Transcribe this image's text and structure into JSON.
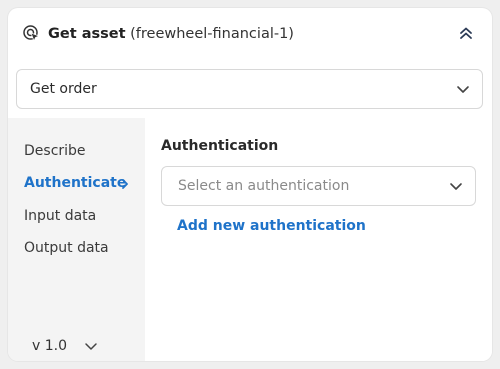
{
  "header": {
    "title": "Get asset",
    "subtitle": "(freewheel-financial-1)",
    "icons": {
      "title_icon": "cursor-click-icon",
      "collapse_icon": "double-chevron-up-icon"
    }
  },
  "operation_select": {
    "value": "Get order",
    "icon": "chevron-down-icon"
  },
  "sidebar": {
    "items": [
      {
        "label": "Describe"
      },
      {
        "label": "Authenticate",
        "active": true
      },
      {
        "label": "Input data"
      },
      {
        "label": "Output data"
      }
    ],
    "version": {
      "label": "v 1.0"
    }
  },
  "content": {
    "section_label": "Authentication",
    "auth_select": {
      "placeholder": "Select an authentication",
      "icon": "chevron-down-icon"
    },
    "add_link": "Add new authentication"
  },
  "colors": {
    "accent": "#1f73c9",
    "sidebar_bg": "#f4f4f4",
    "page_bg": "#efefef"
  }
}
